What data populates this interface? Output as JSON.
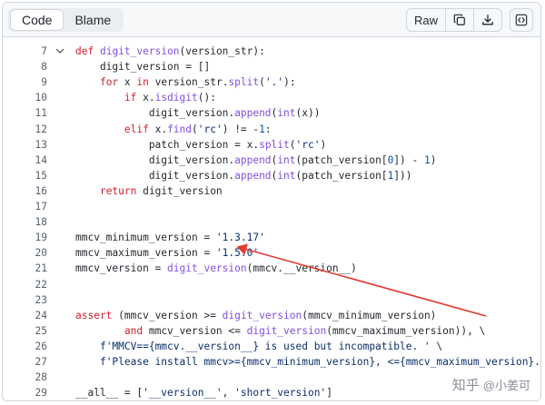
{
  "toolbar": {
    "tab_code": "Code",
    "tab_blame": "Blame",
    "raw_label": "Raw",
    "copy_icon": "copy-icon",
    "download_icon": "download-icon",
    "symbols_icon": "code-symbols-icon"
  },
  "code": {
    "lines": [
      {
        "num": "7",
        "text": "def digit_version(version_str):"
      },
      {
        "num": "8",
        "text": "    digit_version = []"
      },
      {
        "num": "9",
        "text": "    for x in version_str.split('.'):"
      },
      {
        "num": "10",
        "text": "        if x.isdigit():"
      },
      {
        "num": "11",
        "text": "            digit_version.append(int(x))"
      },
      {
        "num": "12",
        "text": "        elif x.find('rc') != -1:"
      },
      {
        "num": "13",
        "text": "            patch_version = x.split('rc')"
      },
      {
        "num": "14",
        "text": "            digit_version.append(int(patch_version[0]) - 1)"
      },
      {
        "num": "15",
        "text": "            digit_version.append(int(patch_version[1]))"
      },
      {
        "num": "16",
        "text": "    return digit_version"
      },
      {
        "num": "17",
        "text": ""
      },
      {
        "num": "18",
        "text": ""
      },
      {
        "num": "19",
        "text": "mmcv_minimum_version = '1.3.17'"
      },
      {
        "num": "20",
        "text": "mmcv_maximum_version = '1.5.0'"
      },
      {
        "num": "21",
        "text": "mmcv_version = digit_version(mmcv.__version__)"
      },
      {
        "num": "22",
        "text": ""
      },
      {
        "num": "23",
        "text": ""
      },
      {
        "num": "24",
        "text": "assert (mmcv_version >= digit_version(mmcv_minimum_version)"
      },
      {
        "num": "25",
        "text": "        and mmcv_version <= digit_version(mmcv_maximum_version)), \\"
      },
      {
        "num": "26",
        "text": "    f'MMCV=={mmcv.__version__} is used but incompatible. ' \\"
      },
      {
        "num": "27",
        "text": "    f'Please install mmcv>={mmcv_minimum_version}, <={mmcv_maximum_version}.'"
      },
      {
        "num": "28",
        "text": ""
      },
      {
        "num": "29",
        "text": "__all__ = ['__version__', 'short_version']"
      }
    ]
  },
  "watermark": {
    "site": "知乎",
    "author": "@小姜可"
  },
  "colors": {
    "keyword": "#cf222e",
    "function": "#8250df",
    "string": "#0a3069",
    "number": "#0550ae",
    "arrow": "#e03c31"
  }
}
